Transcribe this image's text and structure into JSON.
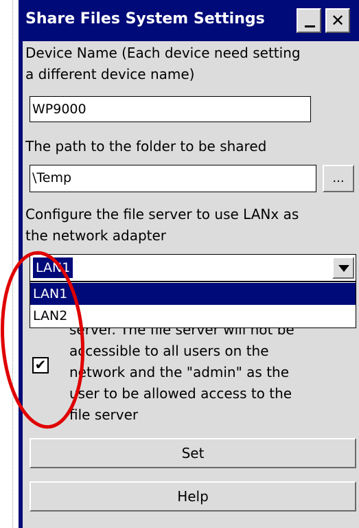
{
  "window": {
    "title": "Share Files System Settings",
    "minimize_symbol": "_",
    "close_symbol": "✕"
  },
  "device_name": {
    "label_line1": "Device Name (Each device need setting",
    "label_line2": "a different device name)",
    "value": "WP9000"
  },
  "shared_path": {
    "label": "The path to the folder to be shared",
    "value": "\\Temp",
    "browse_label": "..."
  },
  "network_adapter": {
    "label_line1": "Configure the file server to use LANx as",
    "label_line2": "the network adapter",
    "selected": "LAN1",
    "options": [
      "LAN1",
      "LAN2"
    ]
  },
  "access_checkbox": {
    "checked": true,
    "mark": "✔",
    "lines": [
      "server. The file server will not be",
      "accessible to all users on the",
      "network and the \"admin\" as the",
      "user to be allowed access to the",
      "file server"
    ]
  },
  "buttons": {
    "set_label": "Set",
    "help_label": "Help"
  },
  "colors": {
    "titlebar": "#000a78",
    "window_bg": "#dcdcdc",
    "selection": "#000a78",
    "annotation": "#e00000"
  }
}
